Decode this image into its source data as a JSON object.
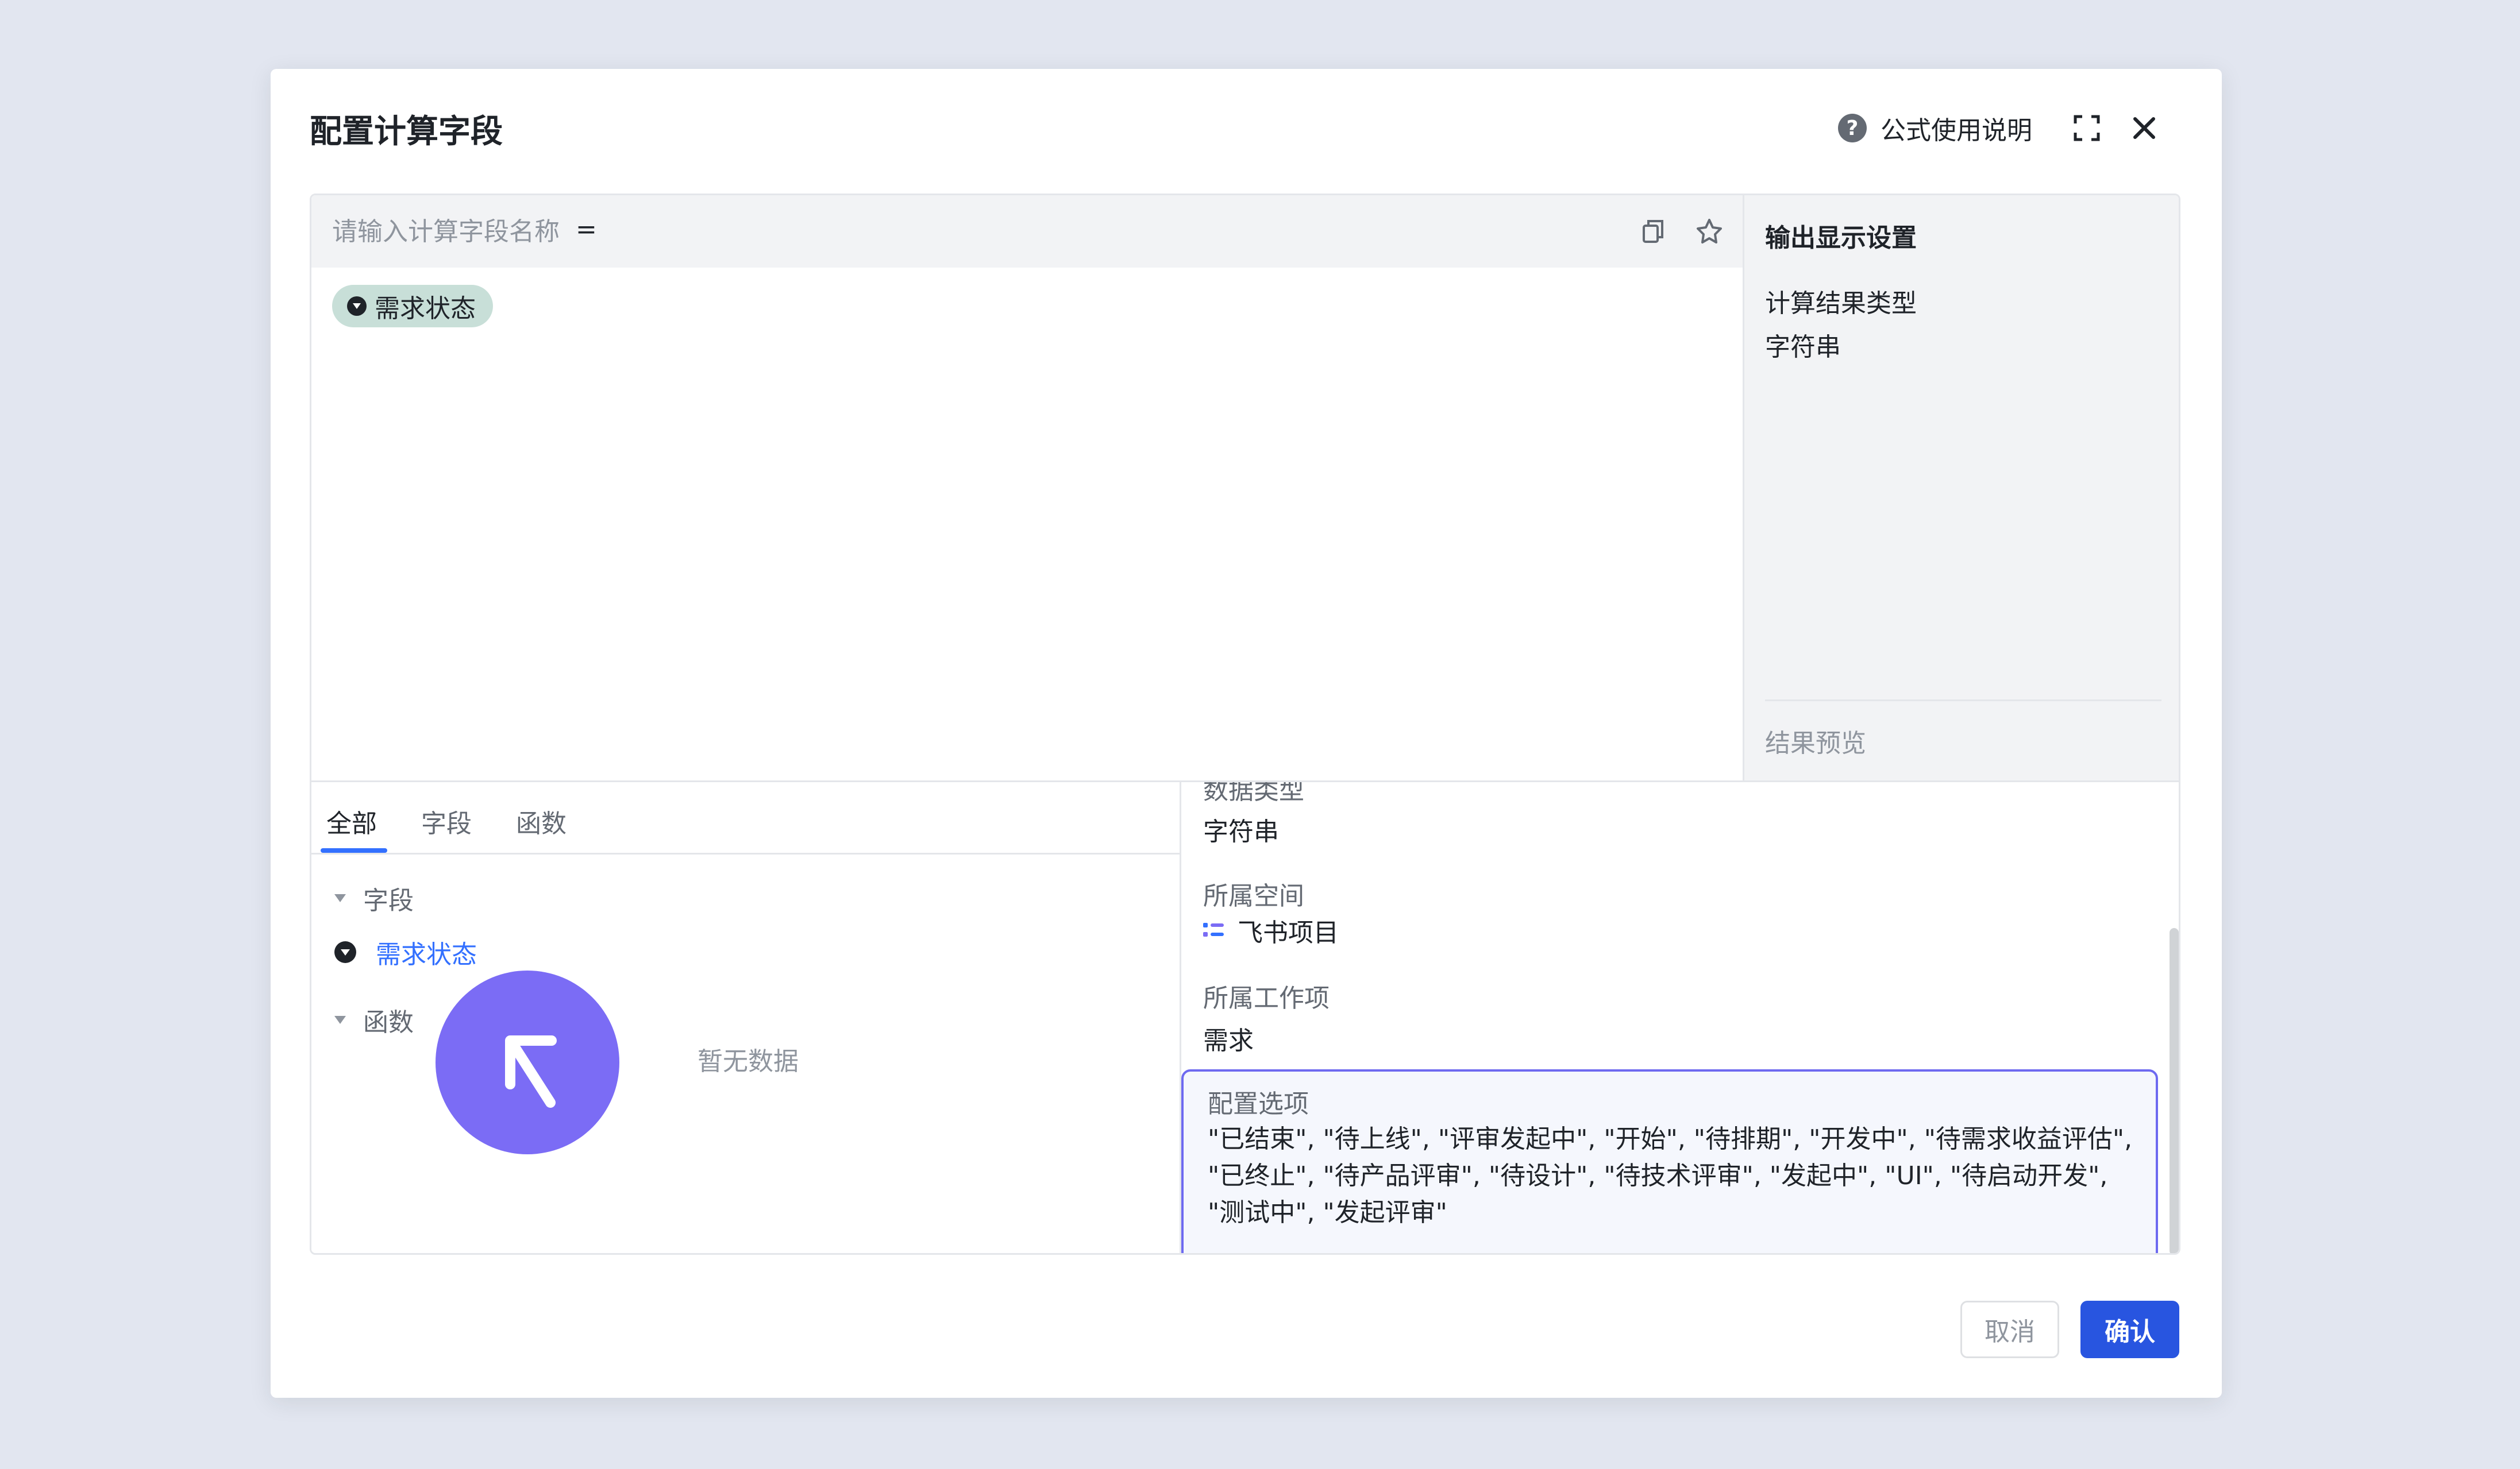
{
  "dialog": {
    "title": "配置计算字段",
    "help_label": "公式使用说明"
  },
  "formula": {
    "name_placeholder": "请输入计算字段名称",
    "equals_sign": "=",
    "token_label": "需求状态"
  },
  "output_settings": {
    "title": "输出显示设置",
    "result_type_label": "计算结果类型",
    "result_type_value": "字符串",
    "preview_label": "结果预览"
  },
  "picker": {
    "tabs": [
      {
        "label": "全部",
        "active": true
      },
      {
        "label": "字段",
        "active": false
      },
      {
        "label": "函数",
        "active": false
      }
    ],
    "groups": {
      "fields": {
        "label": "字段",
        "items": [
          {
            "label": "需求状态"
          }
        ]
      },
      "functions": {
        "label": "函数"
      }
    },
    "empty_text": "暂无数据"
  },
  "field_details": {
    "data_type_label": "数据类型",
    "data_type_value": "字符串",
    "space_label": "所属空间",
    "space_value": "飞书项目",
    "work_item_label": "所属工作项",
    "work_item_value": "需求",
    "options_label": "配置选项",
    "options_text": "\"已结束\", \"待上线\", \"评审发起中\", \"开始\", \"待排期\", \"开发中\", \"待需求收益评估\", \"已终止\", \"待产品评审\", \"待设计\", \"待技术评审\", \"发起中\", \"UI\", \"待启动开发\", \"测试中\", \"发起评审\""
  },
  "footer": {
    "cancel_label": "取消",
    "confirm_label": "确认"
  },
  "colors": {
    "primary": "#2855e0",
    "link": "#3370ff",
    "token_bg": "#c8dfd8",
    "highlight_border": "#6e6af0",
    "cursor_overlay": "#7b6cf5"
  },
  "icons": {
    "help": "help-circle-icon",
    "expand": "expand-icon",
    "close": "close-icon",
    "copy": "copy-icon",
    "favorite": "star-outline-icon",
    "field_type": "select-field-icon",
    "space": "project-list-icon",
    "cursor": "arrow-cursor-icon"
  }
}
